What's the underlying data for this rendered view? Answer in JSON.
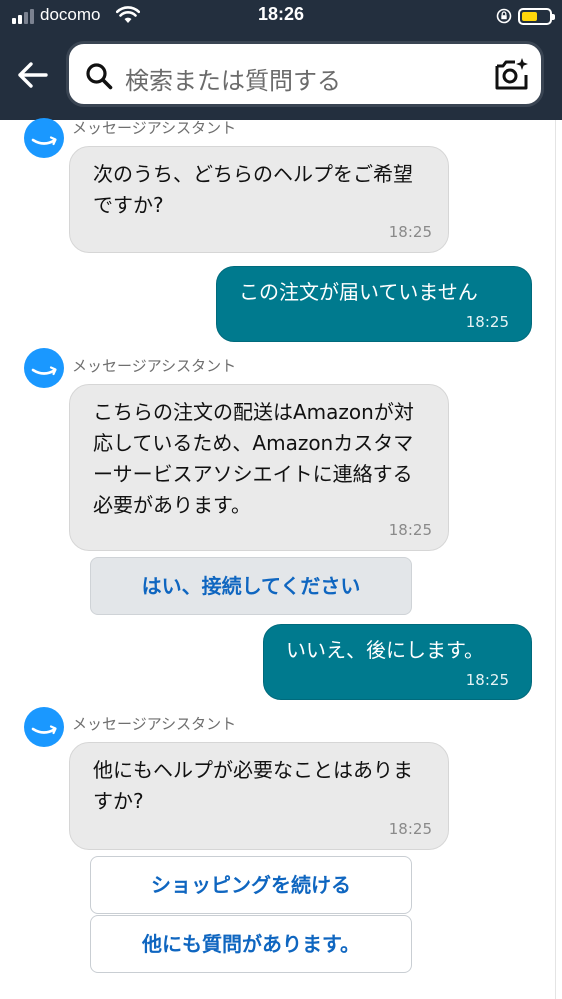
{
  "status_bar": {
    "carrier": "docomo",
    "time": "18:26",
    "battery_level": 0.58,
    "battery_color": "#ffd60a"
  },
  "header": {
    "back_icon": "arrow-left-icon",
    "search_icon": "search-icon",
    "search_placeholder": "検索または質問する",
    "camera_icon": "camera-sparkle-icon",
    "background": "#232f3e"
  },
  "chat": {
    "assistant_name": "メッセージアシスタント",
    "messages": [
      {
        "from": "assistant",
        "text": "次のうち、どちらのヘルプをご希望ですか?",
        "time": "18:25"
      },
      {
        "from": "user",
        "text": "この注文が届いていません",
        "time": "18:25"
      },
      {
        "from": "assistant",
        "text": "こちらの注文の配送はAmazonが対応しているため、Amazonカスタマーサービスアソシエイトに連絡する必要があります。",
        "time": "18:25"
      },
      {
        "from": "user",
        "text": "いいえ、後にします。",
        "time": "18:25"
      },
      {
        "from": "assistant",
        "text": "他にもヘルプが必要なことはありますか?",
        "time": "18:25"
      }
    ],
    "quick_replies_1": [
      "はい、接続してください"
    ],
    "quick_replies_2": [
      "ショッピングを続ける",
      "他にも質問があります。"
    ],
    "user_bubble_color": "#007a8e",
    "assistant_bubble_color": "#eaeaea",
    "link_color": "#0f66c0"
  }
}
